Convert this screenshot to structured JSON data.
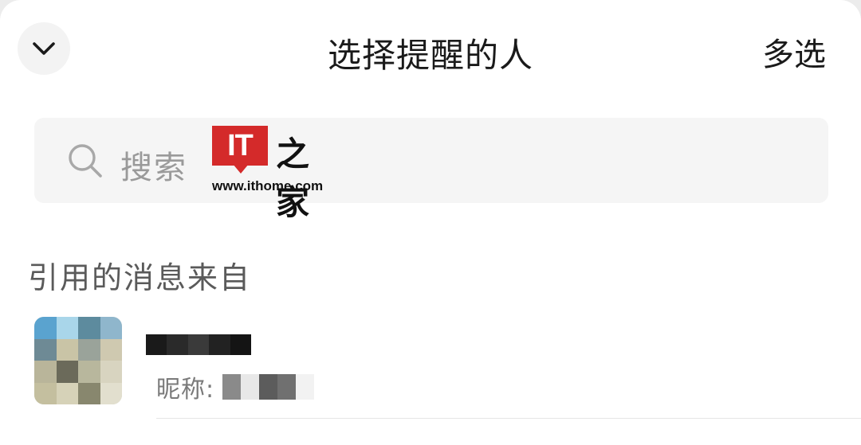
{
  "header": {
    "title": "选择提醒的人",
    "multi_select_label": "多选",
    "collapse_icon": "chevron-down-icon"
  },
  "search": {
    "placeholder": "搜索",
    "icon": "search-icon"
  },
  "watermark": {
    "logo_text": "IT",
    "script_text": "之家",
    "url": "www.ithome.com",
    "brand_color": "#d42a2a"
  },
  "section": {
    "header": "引用的消息来自"
  },
  "contacts": [
    {
      "name": "",
      "nickname_label": "昵称:",
      "nickname_value": "",
      "avatar_pixelated": true
    }
  ],
  "colors": {
    "background": "#ffffff",
    "search_bg": "#f5f5f5",
    "placeholder": "#9a9a9a",
    "section_text": "#5a5a5a"
  }
}
